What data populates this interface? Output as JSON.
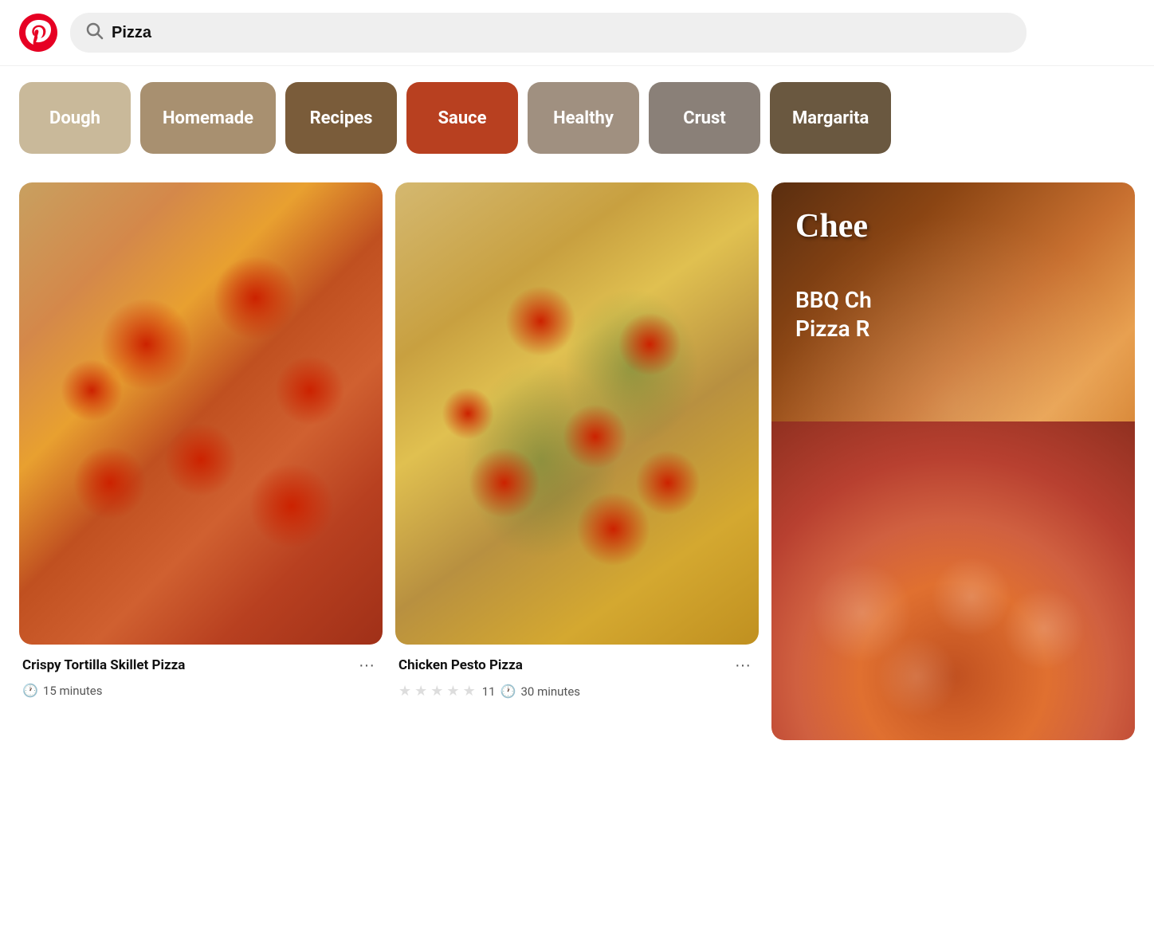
{
  "header": {
    "logo_alt": "Pinterest",
    "search_value": "Pizza",
    "search_placeholder": "Search"
  },
  "categories": [
    {
      "id": "dough",
      "label": "Dough",
      "color": "#c9b99a"
    },
    {
      "id": "homemade",
      "label": "Homemade",
      "color": "#a89070"
    },
    {
      "id": "recipes",
      "label": "Recipes",
      "color": "#7a5c3a"
    },
    {
      "id": "sauce",
      "label": "Sauce",
      "color": "#b84020"
    },
    {
      "id": "healthy",
      "label": "Healthy",
      "color": "#a09080"
    },
    {
      "id": "crust",
      "label": "Crust",
      "color": "#8a8078"
    },
    {
      "id": "margarita",
      "label": "Margarita",
      "color": "#6a5840"
    }
  ],
  "pins": [
    {
      "id": "pin-1",
      "title": "Crispy Tortilla Skillet Pizza",
      "time": "15 minutes",
      "has_stars": false,
      "star_count": 0,
      "review_count": null,
      "column": 1
    },
    {
      "id": "pin-2",
      "title": "Chicken Pesto Pizza",
      "time": "30 minutes",
      "has_stars": true,
      "star_count": 0,
      "review_count": "11",
      "column": 2
    },
    {
      "id": "pin-3",
      "title": "BBQ Chicken Pizza Recipe",
      "time": null,
      "has_stars": false,
      "star_count": 0,
      "review_count": null,
      "column": 3,
      "overlay_text": "Chee",
      "overlay_subtitle": "BBQ Ch\nPizza R"
    }
  ],
  "more_button_label": "···",
  "clock_symbol": "🕐",
  "star_empty": "★",
  "star_filled": "★"
}
